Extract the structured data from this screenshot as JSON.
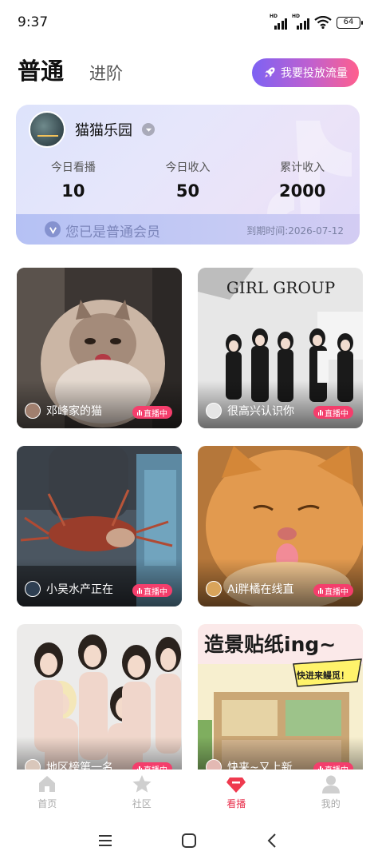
{
  "status_bar": {
    "time": "9:37",
    "net1": "HD",
    "net2": "HD",
    "battery": "64",
    "icons": [
      "signal-icon",
      "signal-icon",
      "wifi-icon",
      "battery-icon"
    ]
  },
  "header": {
    "tab_basic": "普通",
    "tab_advanced": "进阶",
    "boost_button": "我要投放流量",
    "boost_icon": "rocket-icon"
  },
  "member": {
    "name": "猫猫乐园",
    "stats": [
      {
        "label": "今日看播",
        "value": "10"
      },
      {
        "label": "今日收入",
        "value": "50"
      },
      {
        "label": "累计收入",
        "value": "2000"
      }
    ],
    "status": "您已是普通会员",
    "expire": "到期时间:2026-07-12"
  },
  "live_badge": "直播中",
  "streams": [
    {
      "name": "邓峰家的猫"
    },
    {
      "name": "很高兴认识你"
    },
    {
      "name": "小吴水产正在"
    },
    {
      "name": "Ai胖橘在线直"
    },
    {
      "name": "地区榜第一名"
    },
    {
      "name": "快来~又上新"
    }
  ],
  "thumb_text": {
    "girl_group": "GIRL GROUP",
    "sticker_title": "造景贴纸ing~",
    "sticker_sub": "快进来鳗觅！"
  },
  "bottom_nav": [
    {
      "label": "首页",
      "icon": "home-icon"
    },
    {
      "label": "社区",
      "icon": "star-icon"
    },
    {
      "label": "看播",
      "icon": "gem-icon"
    },
    {
      "label": "我的",
      "icon": "person-icon"
    }
  ],
  "colors": {
    "accent": "#e8314d",
    "live": "#f43e6c",
    "boost_start": "#7d62f3",
    "boost_end": "#ff5f8d"
  }
}
